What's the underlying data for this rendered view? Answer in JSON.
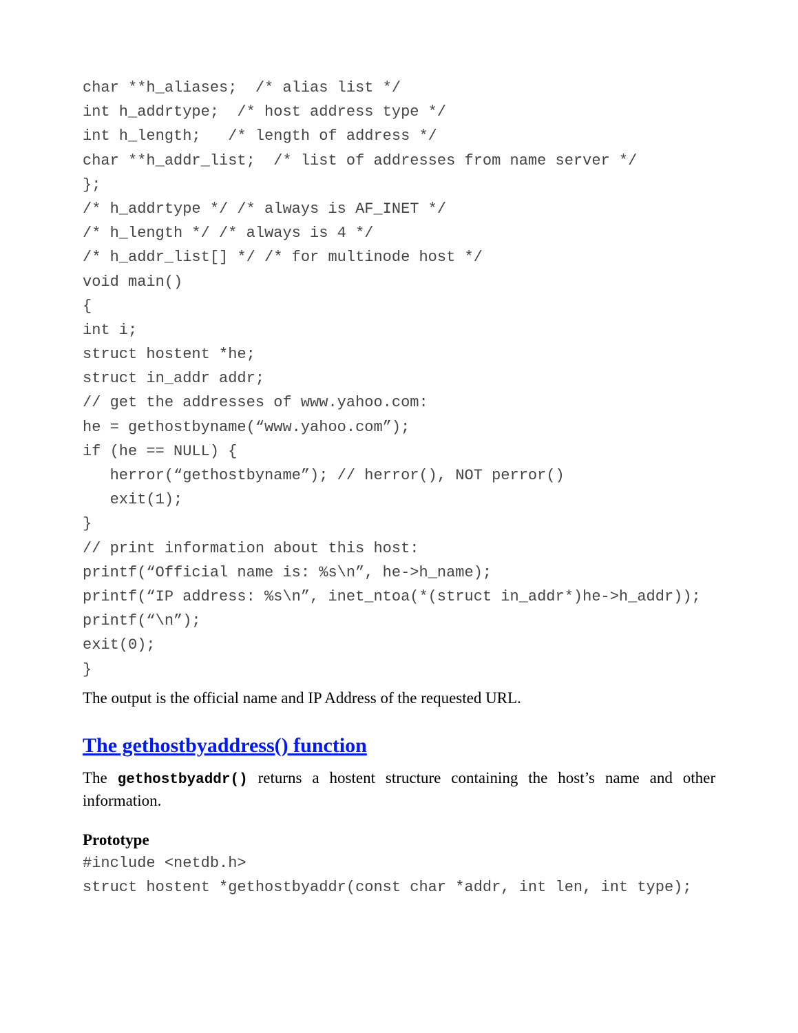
{
  "code_block_1": "char **h_aliases;  /* alias list */\nint h_addrtype;  /* host address type */\nint h_length;   /* length of address */\nchar **h_addr_list;  /* list of addresses from name server */\n};\n/* h_addrtype */ /* always is AF_INET */\n/* h_length */ /* always is 4 */\n/* h_addr_list[] */ /* for multinode host */\nvoid main()\n{\nint i;\nstruct hostent *he;\nstruct in_addr addr;\n// get the addresses of www.yahoo.com:\nhe = gethostbyname(“www.yahoo.com”);\nif (he == NULL) {\n   herror(“gethostbyname”); // herror(), NOT perror()\n   exit(1);\n}\n// print information about this host:\nprintf(“Official name is: %s\\n”, he->h_name);\nprintf(“IP address: %s\\n”, inet_ntoa(*(struct in_addr*)he->h_addr));\nprintf(“\\n”);\nexit(0);\n}",
  "body_paragraph": "The output is the official name and IP Address of the requested URL.",
  "heading": "The gethostbyaddress() function",
  "desc_prefix": "The ",
  "desc_code": "gethostbyaddr()",
  "desc_suffix": " returns a hostent structure containing the host’s name and other information.",
  "subheading": "Prototype",
  "proto_code": "#include <netdb.h>\nstruct hostent *gethostbyaddr(const char *addr, int len, int type);"
}
